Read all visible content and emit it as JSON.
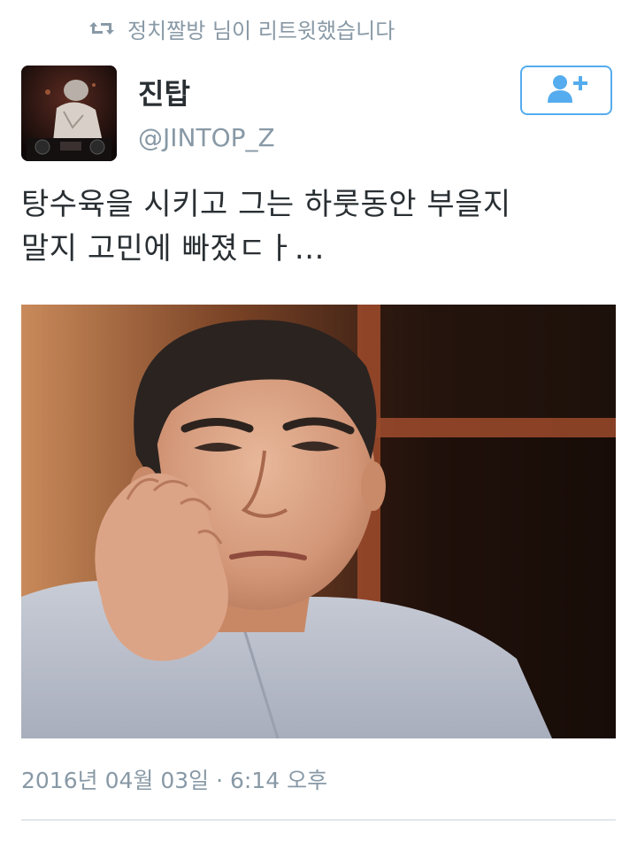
{
  "retweet": {
    "icon": "retweet-icon",
    "text": "정치짤방 님이 리트윗했습니다"
  },
  "author": {
    "display_name": "진탑",
    "handle": "@JINTOP_Z",
    "avatar_icon": "avatar-photo"
  },
  "follow_button": {
    "icon": "add-user-icon",
    "color": "#55acee"
  },
  "tweet": {
    "line1": "탕수육을 시키고 그는 하룻동안 부을지",
    "line2": "말지 고민에 빠졌ㄷㅏ…"
  },
  "media": {
    "kind": "photo"
  },
  "timestamp": "2016년 04월 03일 · 6:14 오후",
  "colors": {
    "accent": "#55acee",
    "secondary_text": "#8899a6",
    "primary_text": "#292f33"
  }
}
